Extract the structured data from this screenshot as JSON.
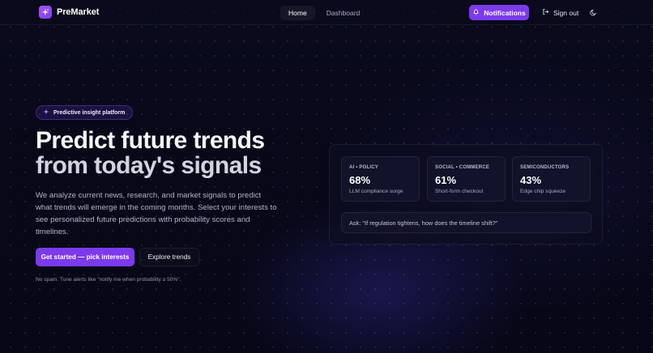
{
  "nav": {
    "brand": "PreMarket",
    "links": [
      {
        "label": "Home",
        "active": true
      },
      {
        "label": "Dashboard",
        "active": false
      }
    ],
    "notifications_label": "Notifications",
    "signout_label": "Sign out",
    "theme_icon": "moon-icon"
  },
  "hero": {
    "badge": "Predictive insight platform",
    "headline_line1": "Predict future trends",
    "headline_line2": "from today's signals",
    "description": "We analyze current news, research, and market signals to predict what trends will emerge in the coming months. Select your interests to see personalized future predictions with probability scores and timelines.",
    "cta_primary": "Get started — pick interests",
    "cta_secondary": "Explore trends",
    "fineprint": "No spam. Tune alerts like \"notify me when probability ≥ 50%\"."
  },
  "panel": {
    "cards": [
      {
        "label": "AI • POLICY",
        "value": "68%",
        "caption": "LLM compliance surge"
      },
      {
        "label": "SOCIAL • COMMERCE",
        "value": "61%",
        "caption": "Short-form checkout"
      },
      {
        "label": "SEMICONDUCTORS",
        "value": "43%",
        "caption": "Edge chip squeeze"
      }
    ],
    "ask": "Ask: \"If regulation tightens, how does the timeline shift?\""
  },
  "colors": {
    "accent": "#7c3aed",
    "background": "#07071a"
  }
}
